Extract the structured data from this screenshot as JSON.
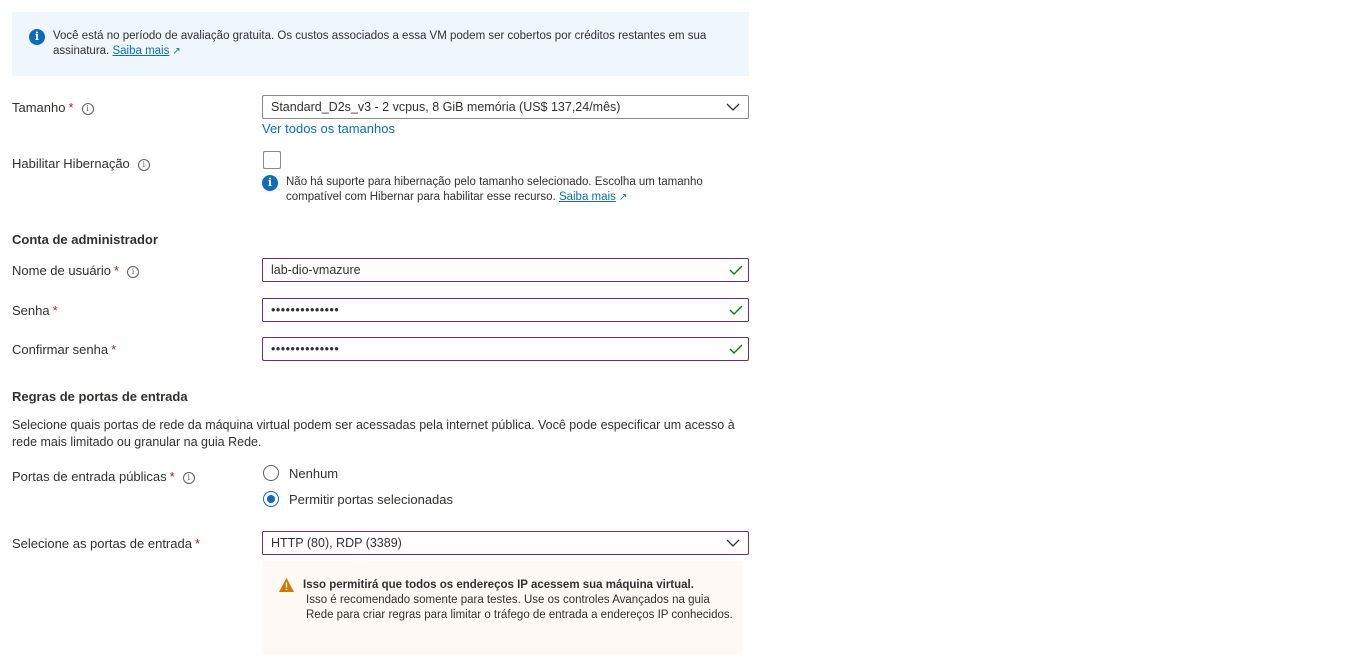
{
  "banner": {
    "text": "Você está no período de avaliação gratuita. Os custos associados a essa VM podem ser cobertos por créditos restantes em sua assinatura.",
    "link": "Saiba mais",
    "icon": "info-icon"
  },
  "size": {
    "label": "Tamanho",
    "required_mark": "*",
    "value": "Standard_D2s_v3 - 2 vcpus, 8 GiB memória (US$ 137,24/mês)",
    "see_all_link": "Ver todos os tamanhos"
  },
  "hibernation": {
    "label": "Habilitar Hibernação",
    "checked": false,
    "info_text": "Não há suporte para hibernação pelo tamanho selecionado. Escolha um tamanho compatível com Hibernar para habilitar esse recurso.",
    "info_link": "Saiba mais"
  },
  "admin": {
    "heading": "Conta de administrador",
    "username_label": "Nome de usuário",
    "username_value": "lab-dio-vmazure",
    "password_label": "Senha",
    "password_value": "••••••••••••••",
    "confirm_label": "Confirmar senha",
    "confirm_value": "••••••••••••••",
    "required_mark": "*"
  },
  "inbound": {
    "heading": "Regras de portas de entrada",
    "description": "Selecione quais portas de rede da máquina virtual podem ser acessadas pela internet pública. Você pode especificar um acesso à rede mais limitado ou granular na guia Rede.",
    "public_ports_label": "Portas de entrada públicas",
    "options": [
      "Nenhum",
      "Permitir portas selecionadas"
    ],
    "selected_option": "Permitir portas selecionadas",
    "select_ports_label": "Selecione as portas de entrada",
    "select_ports_value": "HTTP (80), RDP (3389)",
    "required_mark": "*"
  },
  "warning": {
    "title": "Isso permitirá que todos os endereços IP acessem sua máquina virtual.",
    "body": "Isso é recomendado somente para testes.  Use os controles Avançados na guia Rede para criar regras para limitar o tráfego de entrada a endereços IP conhecidos.",
    "icon": "warning-icon"
  },
  "colors": {
    "accent": "#0f6cbd",
    "required": "#a4262c",
    "valid_check": "#107c10",
    "input_focus_border": "#5c2e91",
    "warning": "#d47500"
  }
}
